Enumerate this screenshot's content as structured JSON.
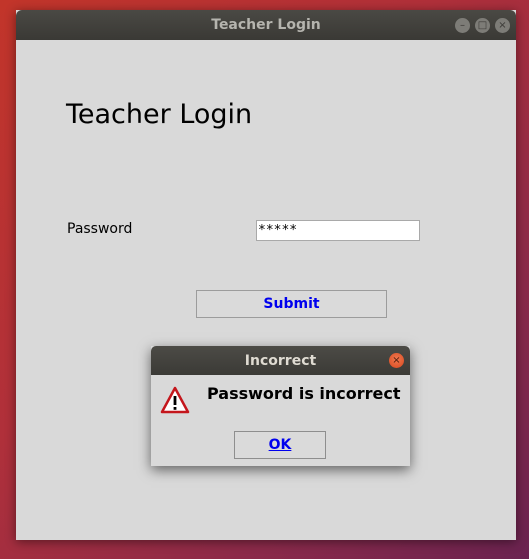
{
  "window": {
    "title": "Teacher Login",
    "controls": {
      "minimize": "–",
      "maximize": "□",
      "close": "×"
    }
  },
  "form": {
    "heading": "Teacher Login",
    "password_label": "Password",
    "password_value": "*****",
    "submit_label": "Submit"
  },
  "dialog": {
    "title": "Incorrect",
    "close_glyph": "×",
    "icon": "warning-icon",
    "message": "Password is incorrect",
    "ok_label": "OK"
  },
  "colors": {
    "button_text": "#0000ee",
    "titlebar": "#3e3d39",
    "window_bg": "#d9d9d9"
  }
}
